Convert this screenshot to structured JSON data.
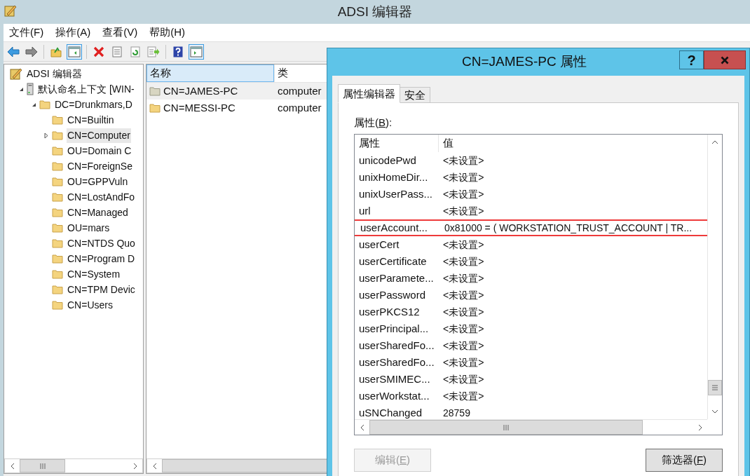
{
  "window": {
    "title": "ADSI 编辑器"
  },
  "menu": [
    {
      "label": "文件(F)"
    },
    {
      "label": "操作(A)"
    },
    {
      "label": "查看(V)"
    },
    {
      "label": "帮助(H)"
    }
  ],
  "toolbar": [
    {
      "kind": "back",
      "pressed": false
    },
    {
      "kind": "forward",
      "pressed": false
    },
    {
      "kind": "sep"
    },
    {
      "kind": "up",
      "pressed": false
    },
    {
      "kind": "tree",
      "pressed": true
    },
    {
      "kind": "sep"
    },
    {
      "kind": "delete",
      "pressed": false
    },
    {
      "kind": "properties",
      "pressed": false
    },
    {
      "kind": "refresh",
      "pressed": false
    },
    {
      "kind": "export",
      "pressed": false
    },
    {
      "kind": "sep"
    },
    {
      "kind": "help",
      "pressed": false
    },
    {
      "kind": "action",
      "pressed": true
    }
  ],
  "tree": [
    {
      "label": "ADSI 编辑器",
      "kind": "app",
      "selected": false,
      "children": [
        {
          "label": "默认命名上下文 [WIN-",
          "kind": "server",
          "selected": false,
          "expanded": true,
          "children": [
            {
              "label": "DC=Drunkmars,D",
              "kind": "folder",
              "selected": false,
              "expanded": true,
              "children": [
                {
                  "label": "CN=Builtin",
                  "kind": "folder",
                  "selected": false
                },
                {
                  "label": "CN=Computer",
                  "kind": "folder",
                  "selected": true,
                  "expanded": false
                },
                {
                  "label": "OU=Domain C",
                  "kind": "folder",
                  "selected": false
                },
                {
                  "label": "CN=ForeignSe",
                  "kind": "folder",
                  "selected": false
                },
                {
                  "label": "OU=GPPVuln",
                  "kind": "folder",
                  "selected": false
                },
                {
                  "label": "CN=LostAndFo",
                  "kind": "folder",
                  "selected": false
                },
                {
                  "label": "CN=Managed",
                  "kind": "folder",
                  "selected": false
                },
                {
                  "label": "OU=mars",
                  "kind": "folder",
                  "selected": false
                },
                {
                  "label": "CN=NTDS Quo",
                  "kind": "folder",
                  "selected": false
                },
                {
                  "label": "CN=Program D",
                  "kind": "folder",
                  "selected": false
                },
                {
                  "label": "CN=System",
                  "kind": "folder",
                  "selected": false
                },
                {
                  "label": "CN=TPM Devic",
                  "kind": "folder",
                  "selected": false
                },
                {
                  "label": "CN=Users",
                  "kind": "folder",
                  "selected": false
                }
              ]
            }
          ]
        }
      ]
    }
  ],
  "list": {
    "columns": [
      {
        "label": "名称",
        "highlighted": true
      },
      {
        "label": "类",
        "highlighted": false
      }
    ],
    "rows": [
      {
        "name": "CN=JAMES-PC",
        "class": "computer",
        "selected": true
      },
      {
        "name": "CN=MESSI-PC",
        "class": "computer",
        "selected": false
      }
    ]
  },
  "dialog": {
    "title": "CN=JAMES-PC 属性",
    "help_button": "?",
    "tabs": [
      {
        "label": "属性编辑器",
        "selected": true
      },
      {
        "label": "安全",
        "selected": false
      }
    ],
    "attributes_label": {
      "before": "属性(",
      "key": "B",
      "after": "):"
    },
    "columns": [
      "属性",
      "值"
    ],
    "rows": [
      {
        "attribute": "unicodePwd",
        "value": "<未设置>",
        "highlighted": false
      },
      {
        "attribute": "unixHomeDir...",
        "value": "<未设置>",
        "highlighted": false
      },
      {
        "attribute": "unixUserPass...",
        "value": "<未设置>",
        "highlighted": false
      },
      {
        "attribute": "url",
        "value": "<未设置>",
        "highlighted": false
      },
      {
        "attribute": "userAccount...",
        "value": "0x81000 = ( WORKSTATION_TRUST_ACCOUNT | TR...",
        "highlighted": true
      },
      {
        "attribute": "userCert",
        "value": "<未设置>",
        "highlighted": false
      },
      {
        "attribute": "userCertificate",
        "value": "<未设置>",
        "highlighted": false
      },
      {
        "attribute": "userParamete...",
        "value": "<未设置>",
        "highlighted": false
      },
      {
        "attribute": "userPassword",
        "value": "<未设置>",
        "highlighted": false
      },
      {
        "attribute": "userPKCS12",
        "value": "<未设置>",
        "highlighted": false
      },
      {
        "attribute": "userPrincipal...",
        "value": "<未设置>",
        "highlighted": false
      },
      {
        "attribute": "userSharedFo...",
        "value": "<未设置>",
        "highlighted": false
      },
      {
        "attribute": "userSharedFo...",
        "value": "<未设置>",
        "highlighted": false
      },
      {
        "attribute": "userSMIMEC...",
        "value": "<未设置>",
        "highlighted": false
      },
      {
        "attribute": "userWorkstat...",
        "value": "<未设置>",
        "highlighted": false
      },
      {
        "attribute": "uSNChanged",
        "value": "28759",
        "highlighted": false
      }
    ],
    "buttons": [
      {
        "before": "编辑(",
        "key": "E",
        "after": ")",
        "disabled": true
      },
      {
        "before": "筛选器(",
        "key": "F",
        "after": ")",
        "disabled": false
      }
    ]
  }
}
